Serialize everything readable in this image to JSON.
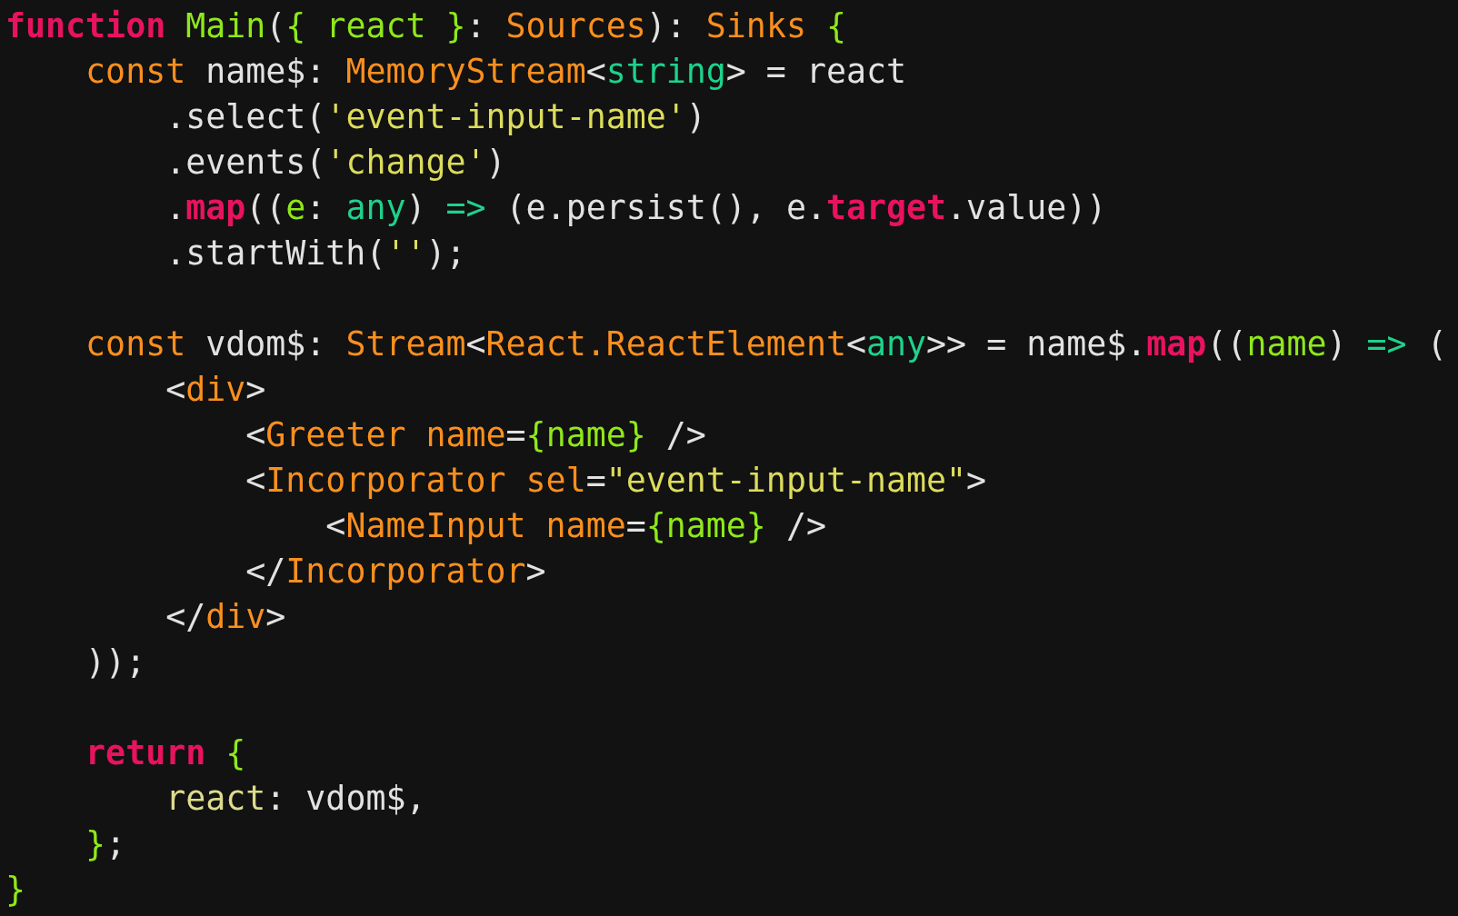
{
  "code_lines": [
    {
      "tokens": [
        {
          "text": "function",
          "kind": "keyword"
        },
        {
          "text": " Main",
          "kind": "green"
        },
        {
          "text": "(",
          "kind": "plain"
        },
        {
          "text": "{ react }",
          "kind": "green"
        },
        {
          "text": ": ",
          "kind": "plain"
        },
        {
          "text": "Sources",
          "kind": "type"
        },
        {
          "text": "): ",
          "kind": "plain"
        },
        {
          "text": "Sinks",
          "kind": "type"
        },
        {
          "text": " {",
          "kind": "green"
        }
      ]
    },
    {
      "tokens": [
        {
          "text": "    const",
          "kind": "type"
        },
        {
          "text": " name$: ",
          "kind": "plain"
        },
        {
          "text": "MemoryStream",
          "kind": "type"
        },
        {
          "text": "<",
          "kind": "plain"
        },
        {
          "text": "string",
          "kind": "teal"
        },
        {
          "text": "> = react",
          "kind": "plain"
        }
      ]
    },
    {
      "tokens": [
        {
          "text": "        .select(",
          "kind": "plain"
        },
        {
          "text": "'event-input-name'",
          "kind": "string"
        },
        {
          "text": ")",
          "kind": "plain"
        }
      ]
    },
    {
      "tokens": [
        {
          "text": "        .events(",
          "kind": "plain"
        },
        {
          "text": "'change'",
          "kind": "string"
        },
        {
          "text": ")",
          "kind": "plain"
        }
      ]
    },
    {
      "tokens": [
        {
          "text": "        .",
          "kind": "plain"
        },
        {
          "text": "map",
          "kind": "keyword"
        },
        {
          "text": "((",
          "kind": "plain"
        },
        {
          "text": "e",
          "kind": "green"
        },
        {
          "text": ": ",
          "kind": "plain"
        },
        {
          "text": "any",
          "kind": "teal"
        },
        {
          "text": ") ",
          "kind": "plain"
        },
        {
          "text": "=>",
          "kind": "teal"
        },
        {
          "text": " (e.persist(), e.",
          "kind": "plain"
        },
        {
          "text": "target",
          "kind": "keyword"
        },
        {
          "text": ".value))",
          "kind": "plain"
        }
      ]
    },
    {
      "tokens": [
        {
          "text": "        .startWith(",
          "kind": "plain"
        },
        {
          "text": "''",
          "kind": "string"
        },
        {
          "text": ");",
          "kind": "plain"
        }
      ]
    },
    {
      "space_before": true,
      "tokens": [
        {
          "text": "    const",
          "kind": "type"
        },
        {
          "text": " vdom$: ",
          "kind": "plain"
        },
        {
          "text": "Stream",
          "kind": "type"
        },
        {
          "text": "<",
          "kind": "plain"
        },
        {
          "text": "React.ReactElement",
          "kind": "type"
        },
        {
          "text": "<",
          "kind": "plain"
        },
        {
          "text": "any",
          "kind": "teal"
        },
        {
          "text": ">> = name$.",
          "kind": "plain"
        },
        {
          "text": "map",
          "kind": "keyword"
        },
        {
          "text": "((",
          "kind": "plain"
        },
        {
          "text": "name",
          "kind": "green"
        },
        {
          "text": ") ",
          "kind": "plain"
        },
        {
          "text": "=>",
          "kind": "teal"
        },
        {
          "text": " (",
          "kind": "plain"
        }
      ]
    },
    {
      "tokens": [
        {
          "text": "        <",
          "kind": "plain"
        },
        {
          "text": "div",
          "kind": "type"
        },
        {
          "text": ">",
          "kind": "plain"
        }
      ]
    },
    {
      "tokens": [
        {
          "text": "            <",
          "kind": "plain"
        },
        {
          "text": "Greeter",
          "kind": "type"
        },
        {
          "text": " name",
          "kind": "type"
        },
        {
          "text": "=",
          "kind": "plain"
        },
        {
          "text": "{name}",
          "kind": "green"
        },
        {
          "text": " />",
          "kind": "plain"
        }
      ]
    },
    {
      "tokens": [
        {
          "text": "            <",
          "kind": "plain"
        },
        {
          "text": "Incorporator",
          "kind": "type"
        },
        {
          "text": " sel",
          "kind": "type"
        },
        {
          "text": "=",
          "kind": "plain"
        },
        {
          "text": "\"event-input-name\"",
          "kind": "string"
        },
        {
          "text": ">",
          "kind": "plain"
        }
      ]
    },
    {
      "tokens": [
        {
          "text": "                <",
          "kind": "plain"
        },
        {
          "text": "NameInput",
          "kind": "type"
        },
        {
          "text": " name",
          "kind": "type"
        },
        {
          "text": "=",
          "kind": "plain"
        },
        {
          "text": "{name}",
          "kind": "green"
        },
        {
          "text": " />",
          "kind": "plain"
        }
      ]
    },
    {
      "tokens": [
        {
          "text": "            </",
          "kind": "plain"
        },
        {
          "text": "Incorporator",
          "kind": "type"
        },
        {
          "text": ">",
          "kind": "plain"
        }
      ]
    },
    {
      "tokens": [
        {
          "text": "        </",
          "kind": "plain"
        },
        {
          "text": "div",
          "kind": "type"
        },
        {
          "text": ">",
          "kind": "plain"
        }
      ]
    },
    {
      "tokens": [
        {
          "text": "    ));",
          "kind": "plain"
        }
      ]
    },
    {
      "space_before": true,
      "tokens": [
        {
          "text": "    return",
          "kind": "keyword"
        },
        {
          "text": " {",
          "kind": "green"
        }
      ]
    },
    {
      "tokens": [
        {
          "text": "        react",
          "kind": "property"
        },
        {
          "text": ": vdom$,",
          "kind": "plain"
        }
      ]
    },
    {
      "tokens": [
        {
          "text": "    }",
          "kind": "green"
        },
        {
          "text": ";",
          "kind": "plain"
        }
      ]
    },
    {
      "tokens": [
        {
          "text": "}",
          "kind": "green"
        }
      ]
    }
  ]
}
